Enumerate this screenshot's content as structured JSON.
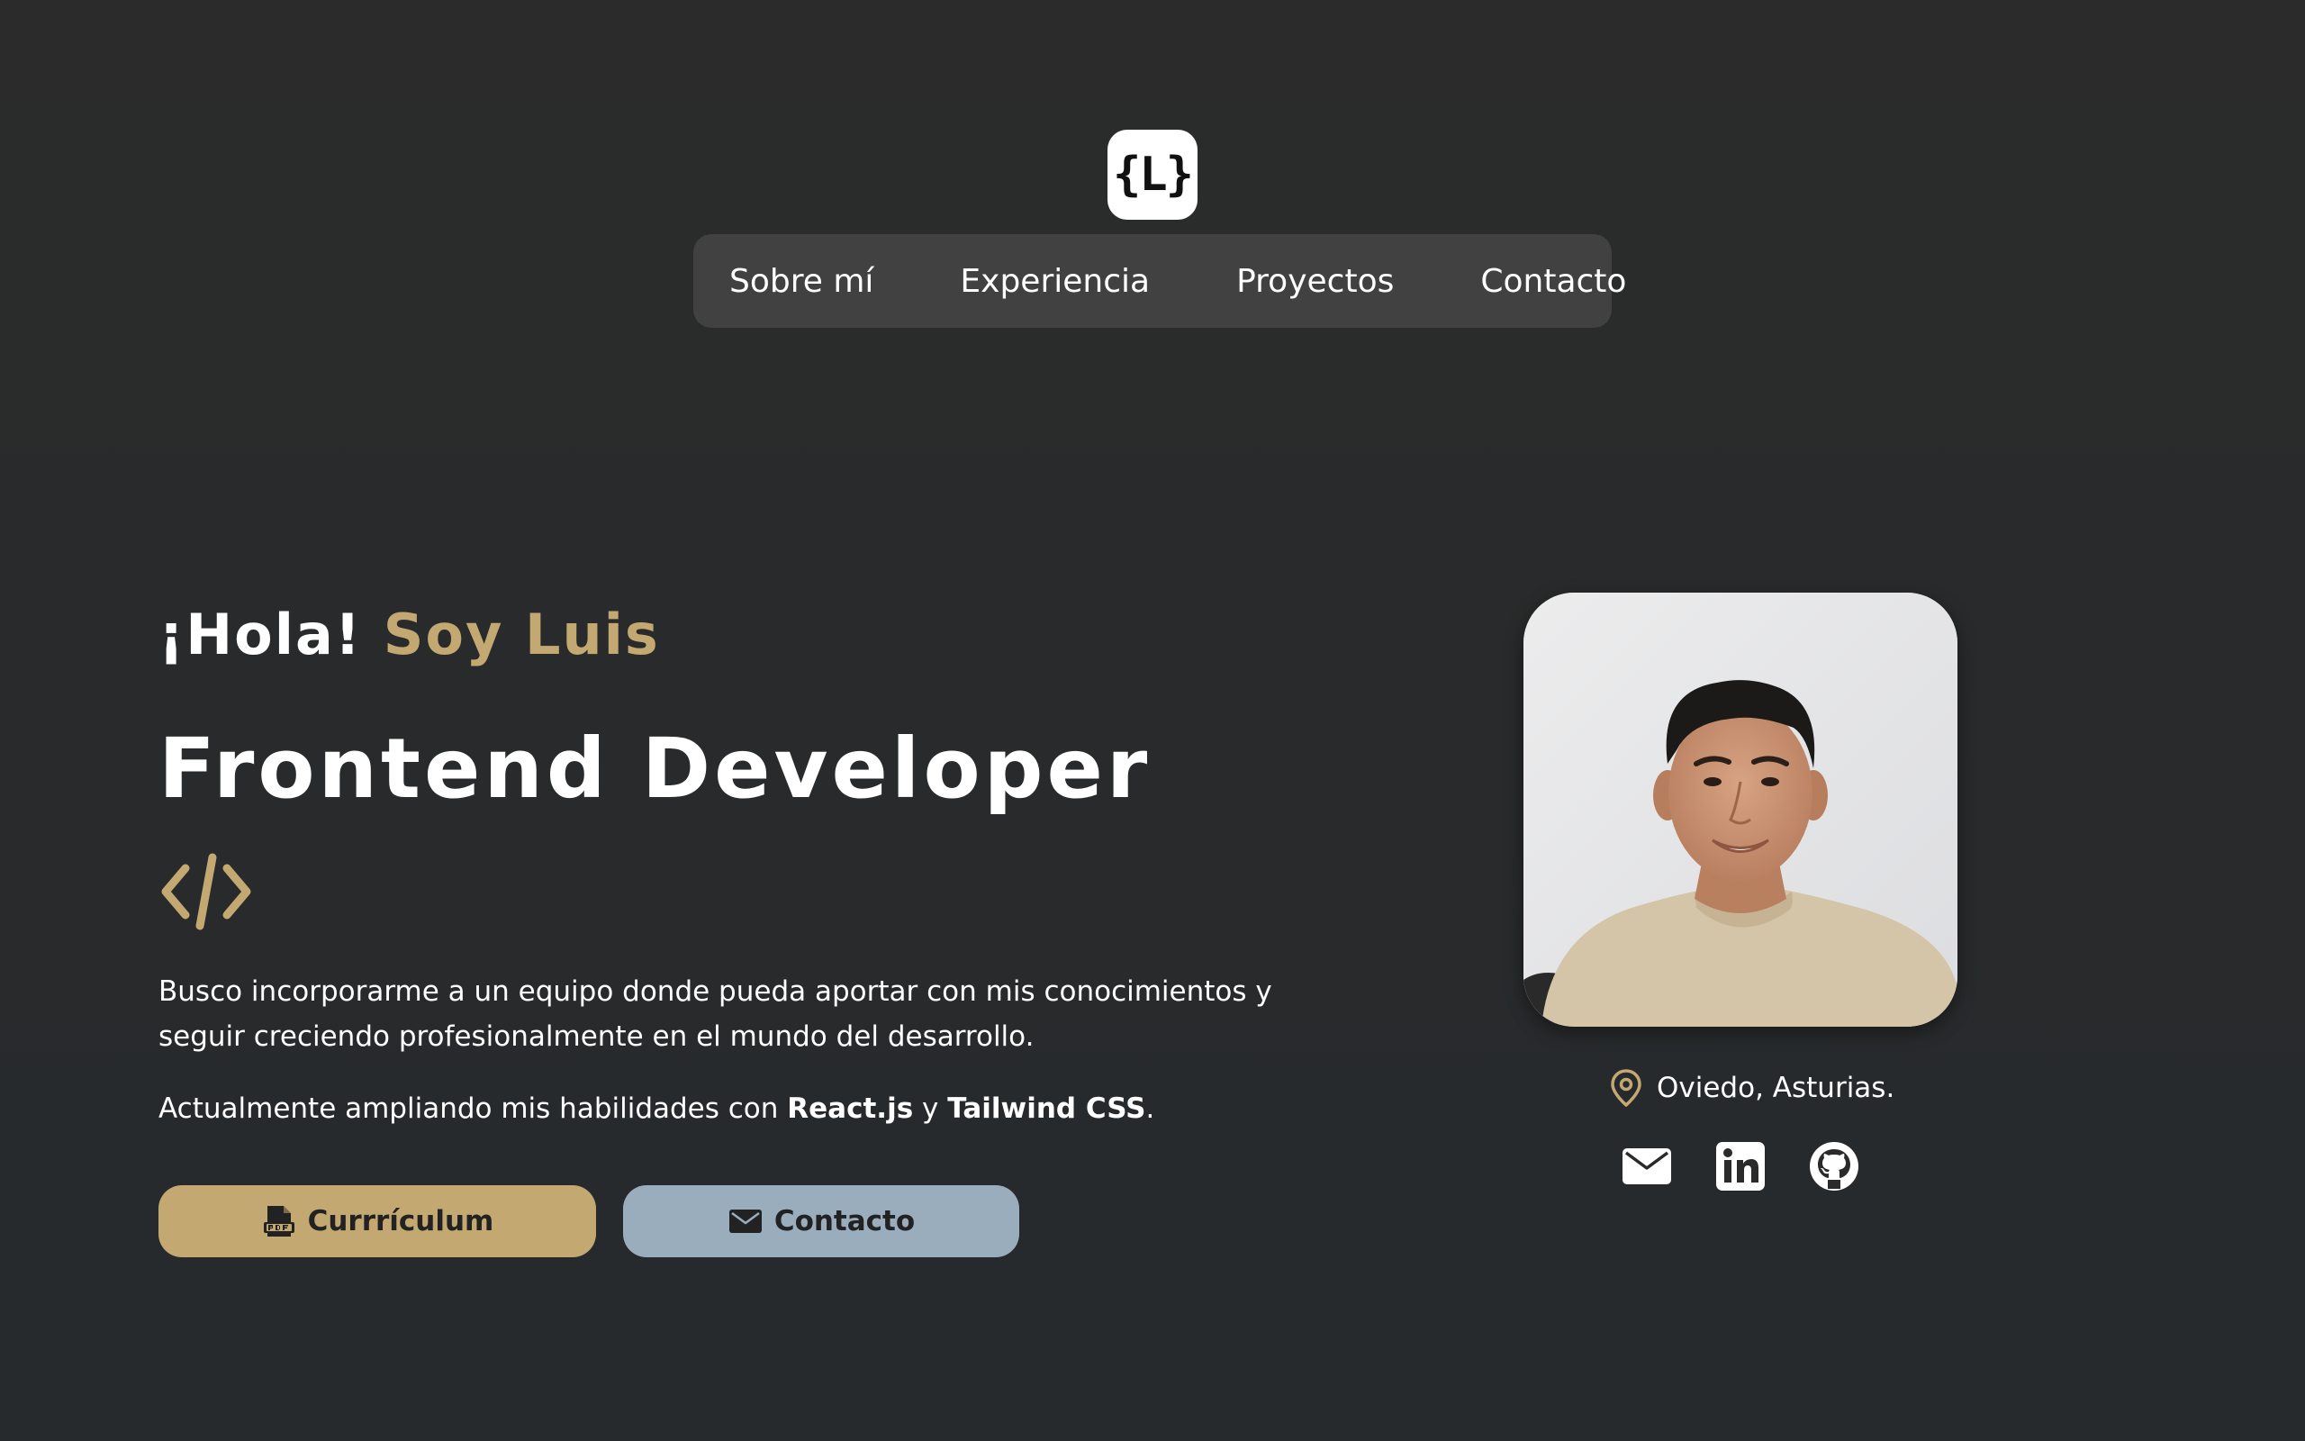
{
  "logo": {
    "text": "{L}"
  },
  "nav": {
    "items": [
      {
        "label": "Sobre mí"
      },
      {
        "label": "Experiencia"
      },
      {
        "label": "Proyectos"
      },
      {
        "label": "Contacto"
      }
    ]
  },
  "hero": {
    "greeting_prefix": "¡Hola!",
    "greeting_name": "Soy Luis",
    "title": "Frontend Developer",
    "description": "Busco incorporarme a un equipo donde pueda aportar con mis conocimientos y seguir creciendo profesionalmente en el mundo del desarrollo.",
    "skills_prefix": "Actualmente ampliando mis habilidades con",
    "skill_1": "React.js",
    "skills_joiner": "y",
    "skill_2": "Tailwind CSS",
    "skills_suffix": ".",
    "buttons": {
      "cv_label": "Currrículum",
      "contact_label": "Contacto"
    }
  },
  "profile": {
    "location": "Oviedo, Asturias.",
    "socials": [
      {
        "icon": "mail-icon"
      },
      {
        "icon": "linkedin-icon"
      },
      {
        "icon": "github-icon"
      }
    ]
  },
  "colors": {
    "accent_gold": "#c4a872",
    "accent_blue": "#9aadbd",
    "background": "#2b2b2b",
    "nav_background": "#414141"
  }
}
